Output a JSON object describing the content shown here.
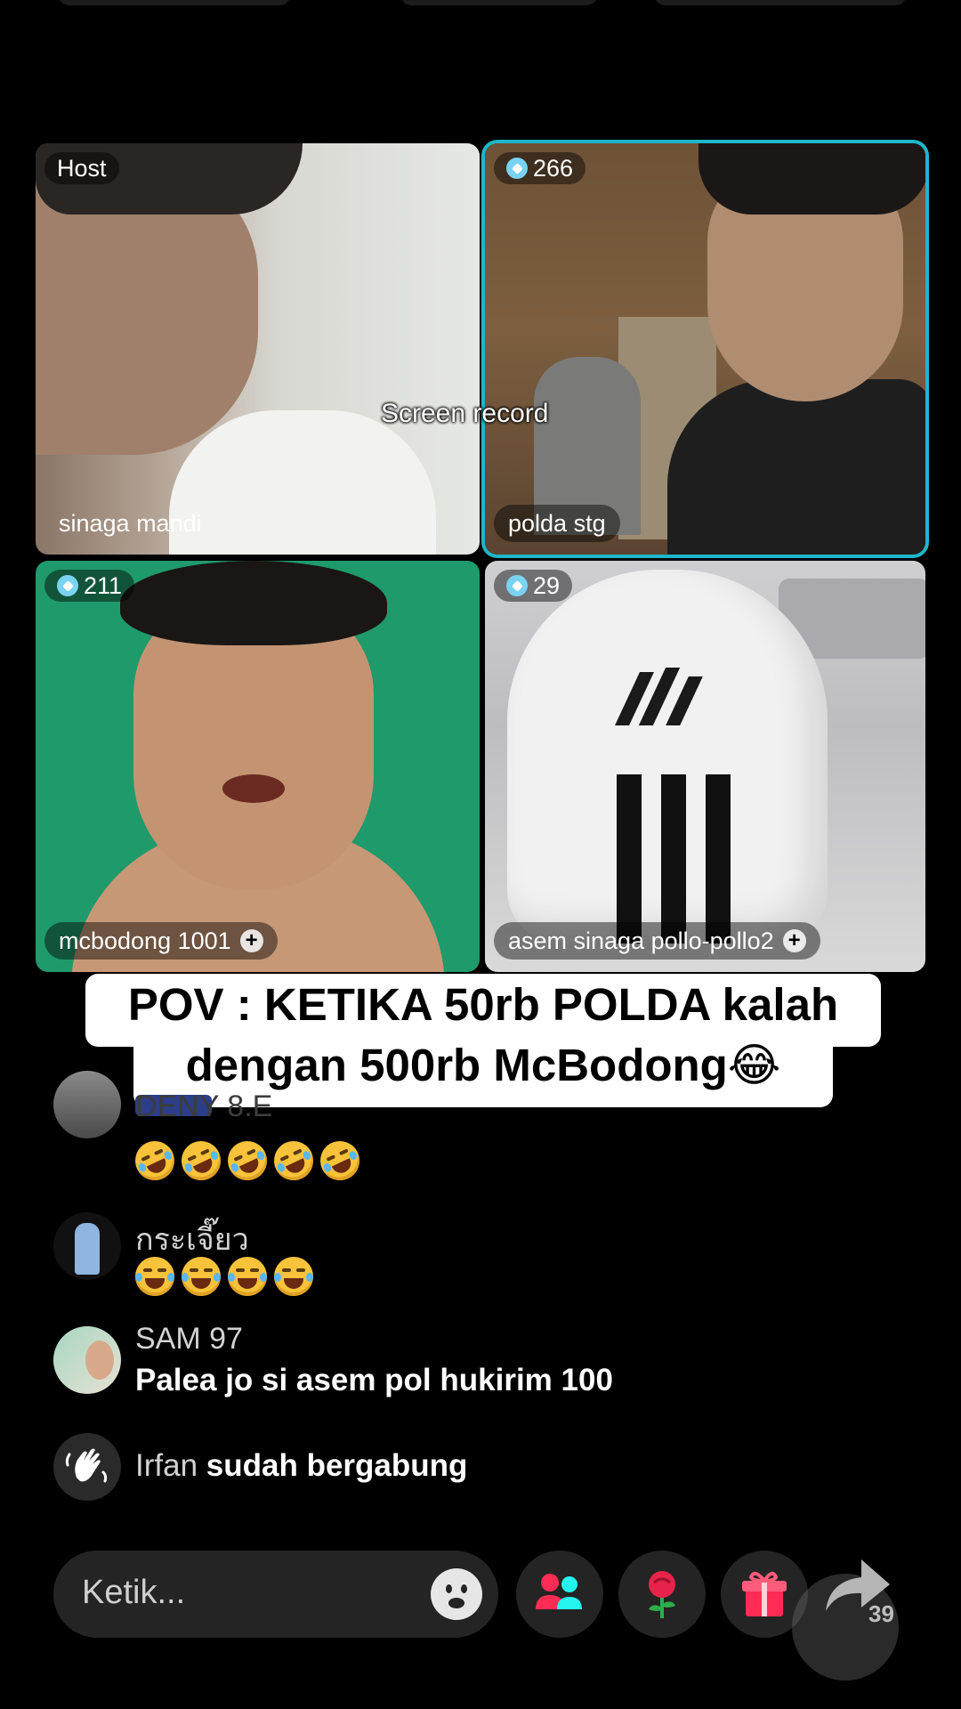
{
  "grid": {
    "host": {
      "badge": "Host",
      "name": "sinaga mandi"
    },
    "guest1": {
      "score": "266",
      "name": "polda stg"
    },
    "guest2": {
      "score": "211",
      "name": "mcbodong 1001"
    },
    "guest3": {
      "score": "29",
      "name": "asem sinaga pollo-pollo2"
    }
  },
  "overlay": {
    "screen_record": "Screen record"
  },
  "caption": {
    "line1": "POV : KETIKA 50rb POLDA kalah",
    "line2": "dengan 500rb McBodong😂"
  },
  "comments": [
    {
      "name": "DENY 8.E",
      "emojis": [
        "rofl",
        "rofl",
        "rofl",
        "rofl",
        "rofl"
      ]
    },
    {
      "name": "กระเจี๊ยว",
      "emojis": [
        "joy",
        "joy",
        "joy",
        "joy"
      ]
    },
    {
      "name": "SAM 97",
      "text": "Palea jo si asem pol hukirim 100"
    },
    {
      "name": "Irfan",
      "text": "sudah bergabung"
    }
  ],
  "bottom_bar": {
    "input_placeholder": "Ketik...",
    "share_count": "39"
  },
  "colors": {
    "active_border": "#1fb6c9",
    "accent_pink": "#fe2c55",
    "teal": "#25f4ee"
  }
}
